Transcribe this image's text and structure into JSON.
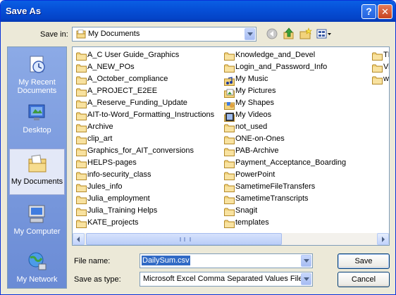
{
  "window": {
    "title": "Save As",
    "help_label": "?",
    "close_label": "✕"
  },
  "save_in": {
    "label": "Save in:",
    "value": "My Documents"
  },
  "toolbar": {
    "icons": [
      "back-icon",
      "up-folder-icon",
      "new-folder-icon",
      "views-menu-icon"
    ]
  },
  "places": [
    {
      "label": "My Recent Documents",
      "icon": "recent-documents-icon"
    },
    {
      "label": "Desktop",
      "icon": "desktop-icon"
    },
    {
      "label": "My Documents",
      "icon": "my-documents-icon",
      "selected": true
    },
    {
      "label": "My Computer",
      "icon": "my-computer-icon"
    },
    {
      "label": "My Network",
      "icon": "my-network-icon"
    }
  ],
  "files": {
    "col1": [
      "A_C User Guide_Graphics",
      "A_NEW_POs",
      "A_October_compliance",
      "A_PROJECT_E2EE",
      "A_Reserve_Funding_Update",
      "AIT-to-Word_Formatting_Instructions",
      "Archive",
      "clip_art",
      "Graphics_for_AIT_conversions",
      "HELPS-pages",
      "info-security_class",
      "Jules_info",
      "Julia_employment",
      "Julia_Training Helps",
      "KATE_projects"
    ],
    "col2": [
      "Knowledge_and_Devel",
      "Login_and_Password_Info",
      "My Music",
      "My Pictures",
      "My Shapes",
      "My Videos",
      "not_used",
      "ONE-on-Ones",
      "PAB-Archive",
      "Payment_Acceptance_Boarding",
      "PowerPoint",
      "SametimeFileTransfers",
      "SametimeTranscripts",
      "Snagit",
      "templates"
    ],
    "col3": [
      "TF",
      "Vi",
      "w"
    ]
  },
  "file_name": {
    "label": "File name:",
    "value": "DailySum.csv"
  },
  "save_as_type": {
    "label": "Save as type:",
    "value": "Microsoft Excel Comma Separated Values File"
  },
  "buttons": {
    "save": "Save",
    "cancel": "Cancel"
  }
}
